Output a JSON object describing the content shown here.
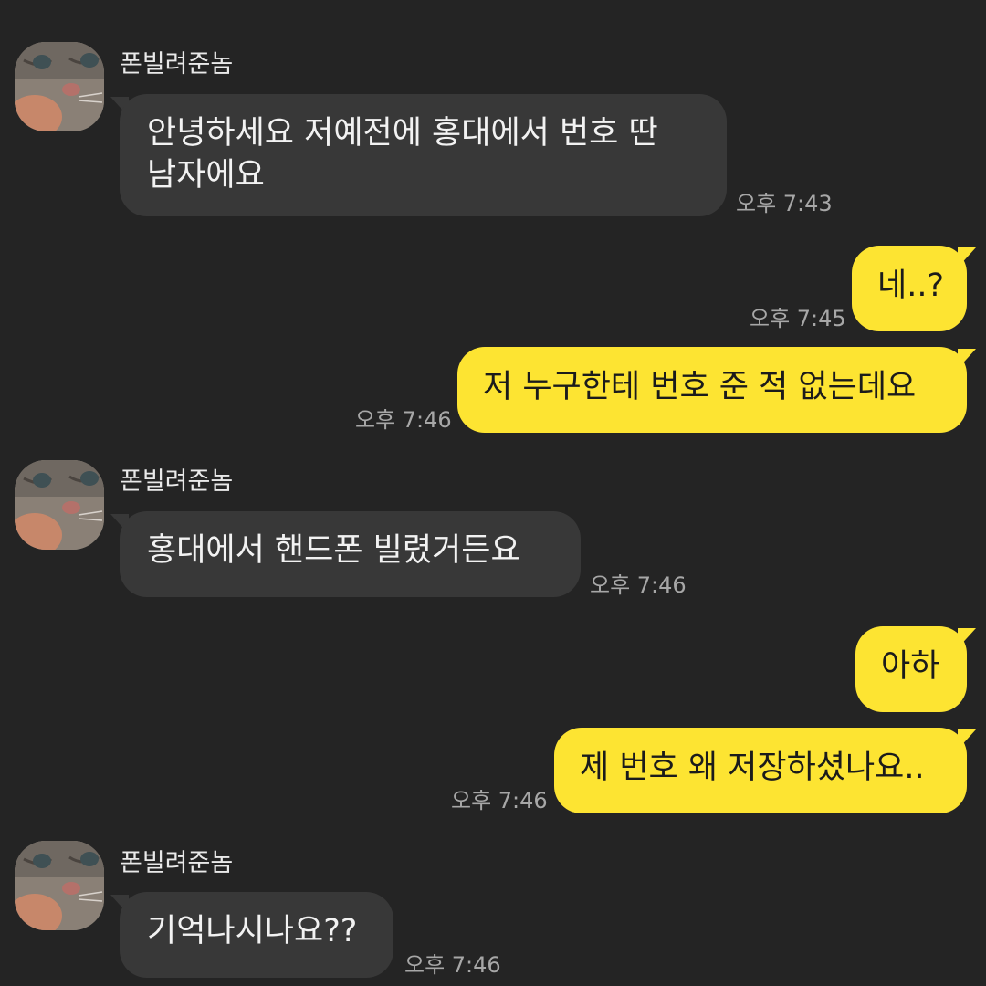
{
  "colors": {
    "background": "#242424",
    "incoming_bubble": "#383838",
    "outgoing_bubble": "#fde432"
  },
  "messages": [
    {
      "sender": "폰빌려준놈",
      "text": "안녕하세요 저예전에 홍대에서 번호 딴\n남자에요",
      "time": "오후 7:43"
    },
    {
      "text": "네..?",
      "time": "오후 7:45"
    },
    {
      "text": "저 누구한테 번호 준 적 없는데요",
      "time": "오후 7:46"
    },
    {
      "sender": "폰빌려준놈",
      "text": "홍대에서 핸드폰 빌렸거든요",
      "time": "오후 7:46"
    },
    {
      "text": "아하"
    },
    {
      "text": "제 번호 왜 저장하셨나요..",
      "time": "오후 7:46"
    },
    {
      "sender": "폰빌려준놈",
      "text": "기억나시나요??",
      "time": "오후 7:46"
    }
  ]
}
